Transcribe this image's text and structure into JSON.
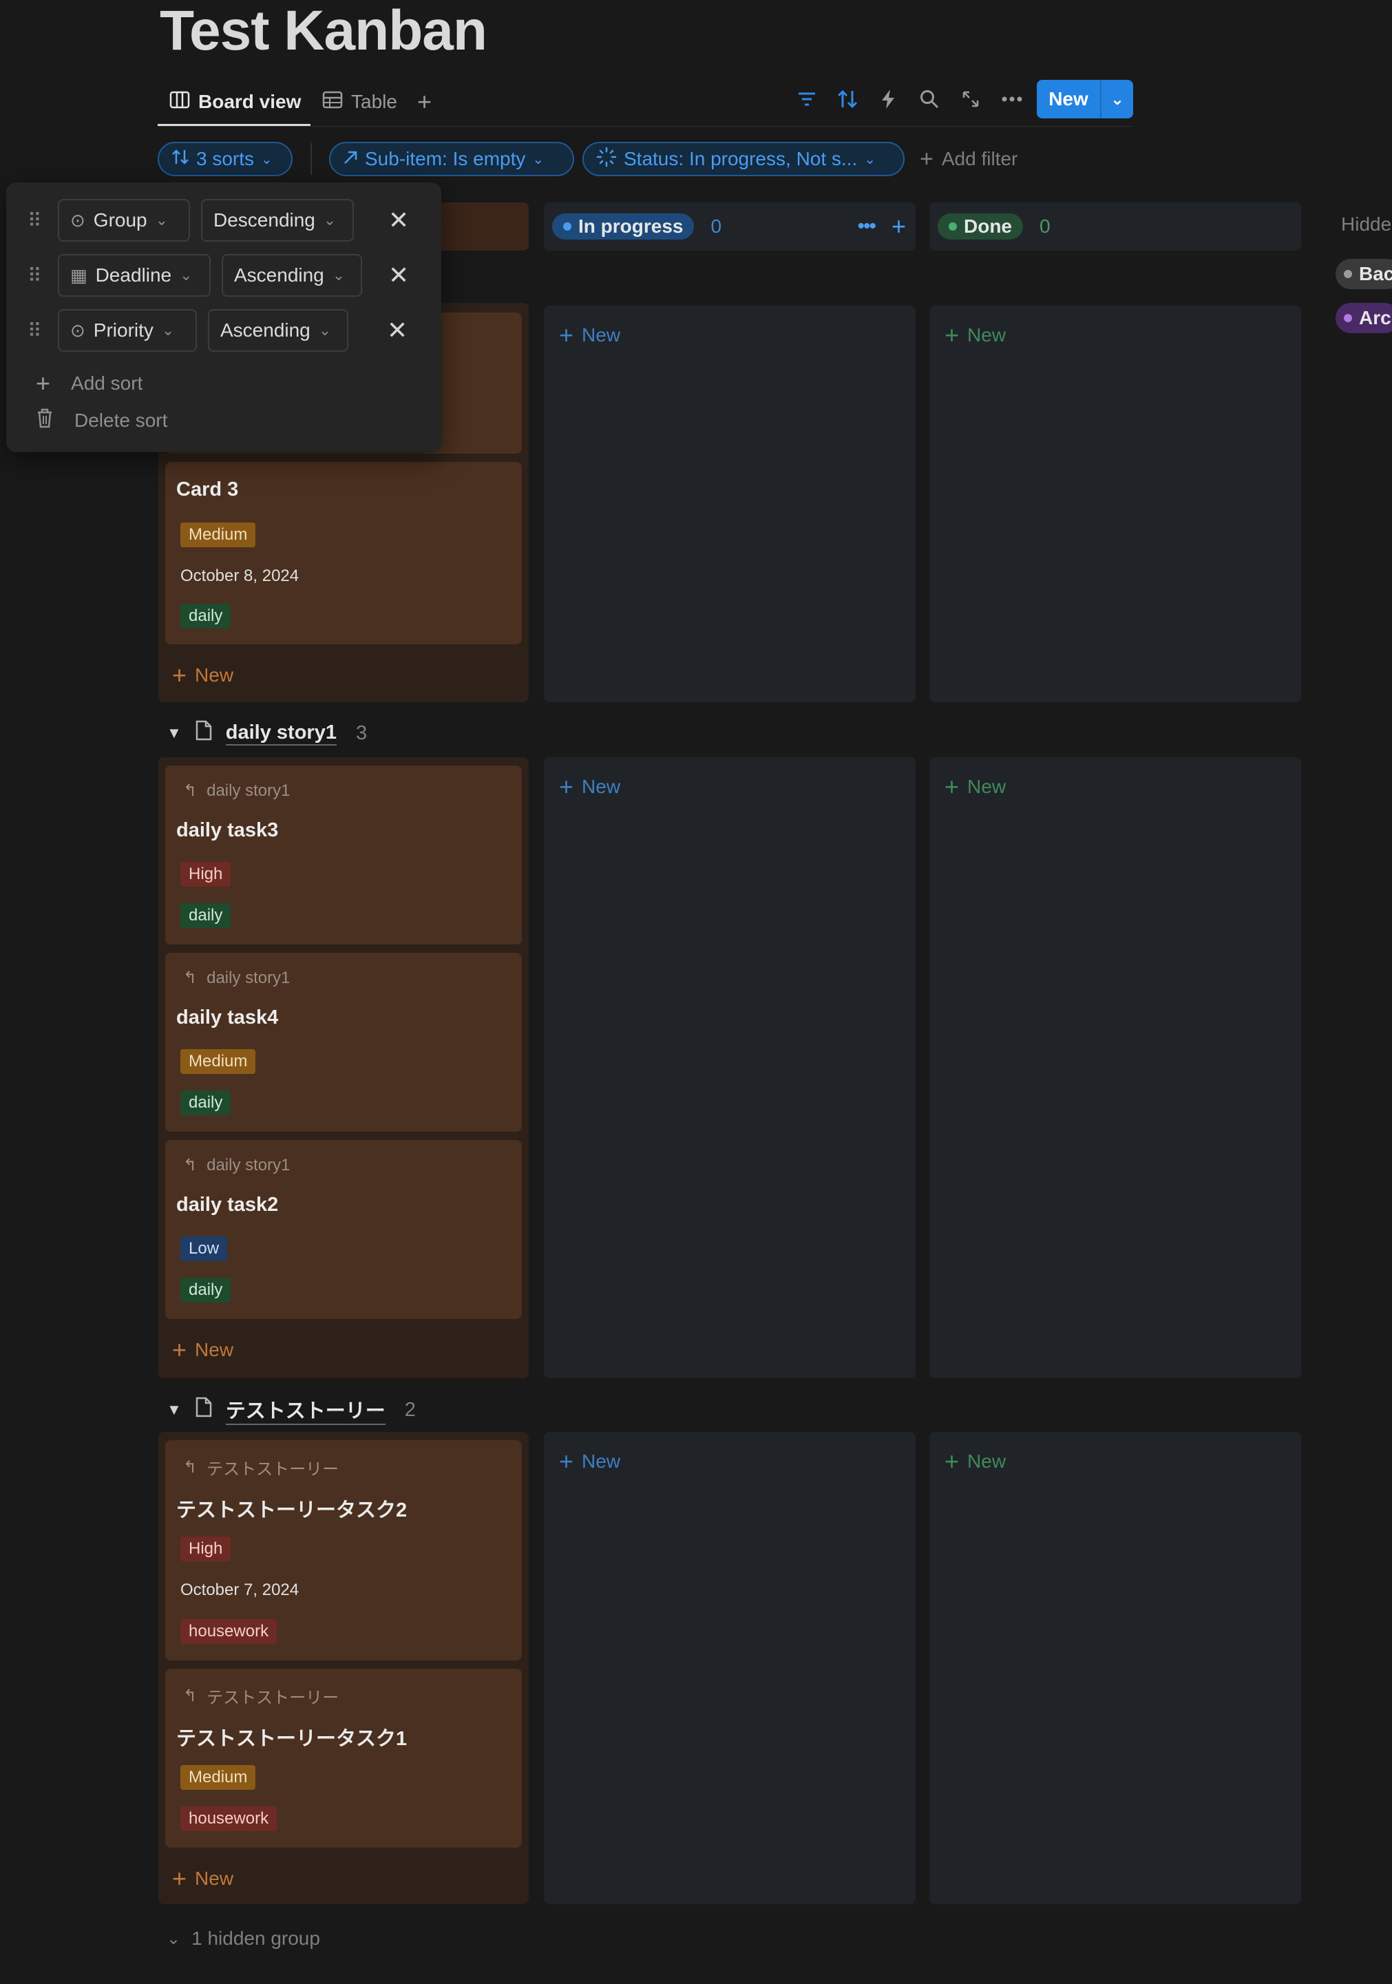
{
  "page": {
    "title": "Test Kanban"
  },
  "tabs": [
    {
      "label": "Board view",
      "icon": "board-icon",
      "active": true
    },
    {
      "label": "Table",
      "icon": "table-icon",
      "active": false
    }
  ],
  "toolbar": {
    "new_label": "New"
  },
  "filters": {
    "sorts": "3 sorts",
    "subitem": "Sub-item: Is empty",
    "status": "Status: In progress, Not s...",
    "add_filter": "Add filter"
  },
  "columns": {
    "in_progress": {
      "label": "In progress",
      "count": "0",
      "color": "#2f6fb8"
    },
    "done": {
      "label": "Done",
      "count": "0",
      "color": "#2e6b45"
    },
    "new_label": "New"
  },
  "sort_popover": {
    "rows": [
      {
        "property": "Group",
        "direction": "Descending"
      },
      {
        "property": "Deadline",
        "direction": "Ascending"
      },
      {
        "property": "Priority",
        "direction": "Ascending"
      }
    ],
    "add_sort": "Add sort",
    "delete_sort": "Delete sort"
  },
  "group1": {
    "card3": {
      "title": "Card 3",
      "priority": "Medium",
      "date": "October 8, 2024",
      "tag": "daily"
    },
    "new_label": "New"
  },
  "group2": {
    "name": "daily story1",
    "count": "3",
    "cards": [
      {
        "parent": "daily story1",
        "title": "daily task3",
        "priority": "High",
        "tag": "daily"
      },
      {
        "parent": "daily story1",
        "title": "daily task4",
        "priority": "Medium",
        "tag": "daily"
      },
      {
        "parent": "daily story1",
        "title": "daily task2",
        "priority": "Low",
        "tag": "daily"
      }
    ],
    "new_label": "New"
  },
  "group3": {
    "name": "テストストーリー",
    "count": "2",
    "cards": [
      {
        "parent": "テストストーリー",
        "title": "テストストーリータスク2",
        "priority": "High",
        "date": "October 7, 2024",
        "tag": "housework"
      },
      {
        "parent": "テストストーリー",
        "title": "テストストーリータスク1",
        "priority": "Medium",
        "tag": "housework"
      }
    ],
    "new_label": "New"
  },
  "hidden": {
    "label": "Hidde",
    "chip1": "Bac",
    "chip2": "Arc",
    "hidden_group": "1 hidden group"
  }
}
